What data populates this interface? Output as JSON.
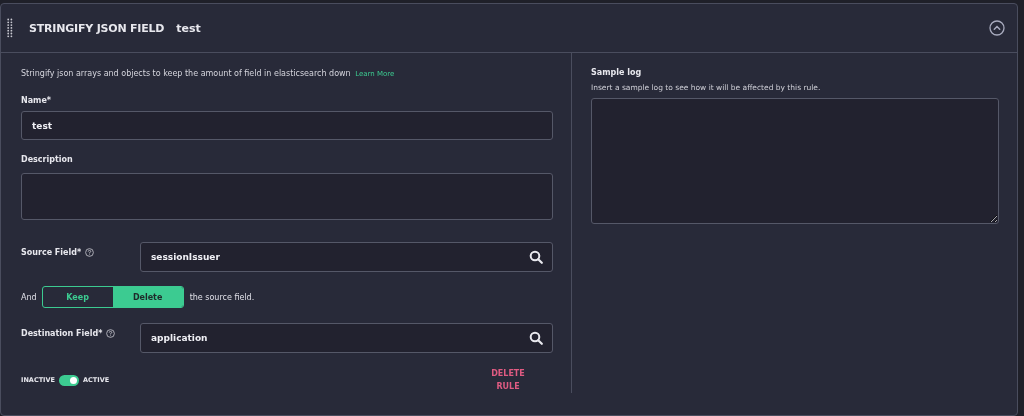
{
  "header": {
    "title": "STRINGIFY JSON FIELD",
    "rule_name": "test",
    "expanded": true
  },
  "description": "Stringify json arrays and objects to keep the amount of field in elasticsearch down",
  "learn_more": "Learn More",
  "name_field": {
    "label": "Name*",
    "value": "test"
  },
  "description_field": {
    "label": "Description"
  },
  "source_field": {
    "label": "Source Field*",
    "value": "sessionIssuer"
  },
  "source_action": {
    "prefix": "And",
    "options": [
      {
        "label": "Keep",
        "selected": false
      },
      {
        "label": "Delete",
        "selected": true
      }
    ],
    "suffix": "the source field."
  },
  "destination_field": {
    "label": "Destination Field*",
    "value": "application"
  },
  "status": {
    "off_label": "INACTIVE",
    "on_label": "ACTIVE",
    "on": true
  },
  "delete_button": "DELETE RULE",
  "sample_log": {
    "title": "Sample log",
    "hint": "Insert a sample log to see how it will be affected by this rule."
  }
}
